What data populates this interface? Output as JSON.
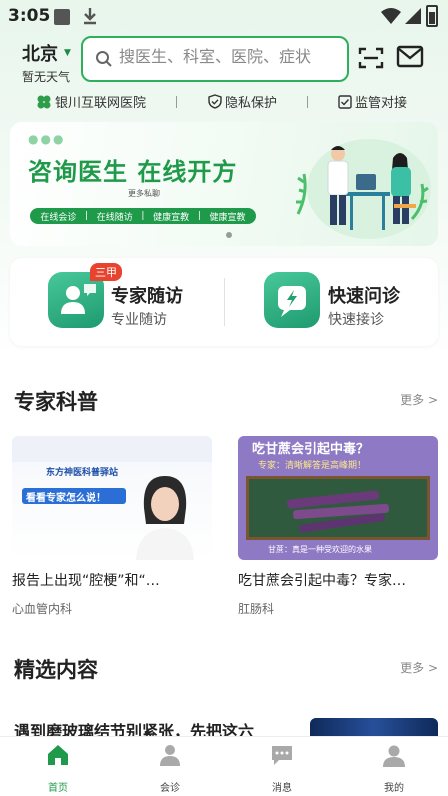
{
  "status_bar": {
    "time": "3:05"
  },
  "header": {
    "city": "北京",
    "weather": "暂无天气",
    "search_placeholder": "搜医生、科室、医院、症状"
  },
  "info_strip": [
    {
      "label": "银川互联网医院",
      "icon": "clover-icon"
    },
    {
      "label": "隐私保护",
      "icon": "shield-check-icon"
    },
    {
      "label": "监管对接",
      "icon": "checkbox-icon"
    }
  ],
  "banner": {
    "title": "咨询医生 在线开方",
    "subtitle": "更多私聊",
    "tags": [
      "在线会诊",
      "在线随访",
      "健康宣教",
      "健康宣教"
    ],
    "page_count": 1
  },
  "services": [
    {
      "title": "专家随访",
      "subtitle": "专业随访",
      "badge": "三甲",
      "icon": "doctor-chat-icon"
    },
    {
      "title": "快速问诊",
      "subtitle": "快速接诊",
      "icon": "lightning-chat-icon"
    }
  ],
  "sections": {
    "popular_science": {
      "title": "专家科普",
      "more": "更多 >"
    },
    "featured": {
      "title": "精选内容",
      "more": "更多 >"
    }
  },
  "articles": [
    {
      "title": "报告上出现“腔梗”和“…",
      "category": "心血管内科",
      "image_texts": [
        "东方神医科普驿站",
        "看看专家怎么说！"
      ]
    },
    {
      "title": "吃甘蔗会引起中毒？专家…",
      "category": "肛肠科",
      "image_texts": [
        "吃甘蔗会引起中毒？",
        "专家：清晰解答是高峰期！",
        "甘蔗：真是一种受欢迎的水果"
      ]
    }
  ],
  "featured_item": {
    "title": "遇到磨玻璃结节别紧张，先把这六"
  },
  "tab_bar": [
    {
      "label": "首页",
      "icon": "home-icon",
      "active": true
    },
    {
      "label": "会诊",
      "icon": "person-icon",
      "active": false
    },
    {
      "label": "消息",
      "icon": "message-icon",
      "active": false
    },
    {
      "label": "我的",
      "icon": "profile-icon",
      "active": false
    }
  ],
  "colors": {
    "brand_green": "#1f9a4a",
    "badge_red": "#e8432f",
    "search_border": "#2fae5b"
  }
}
